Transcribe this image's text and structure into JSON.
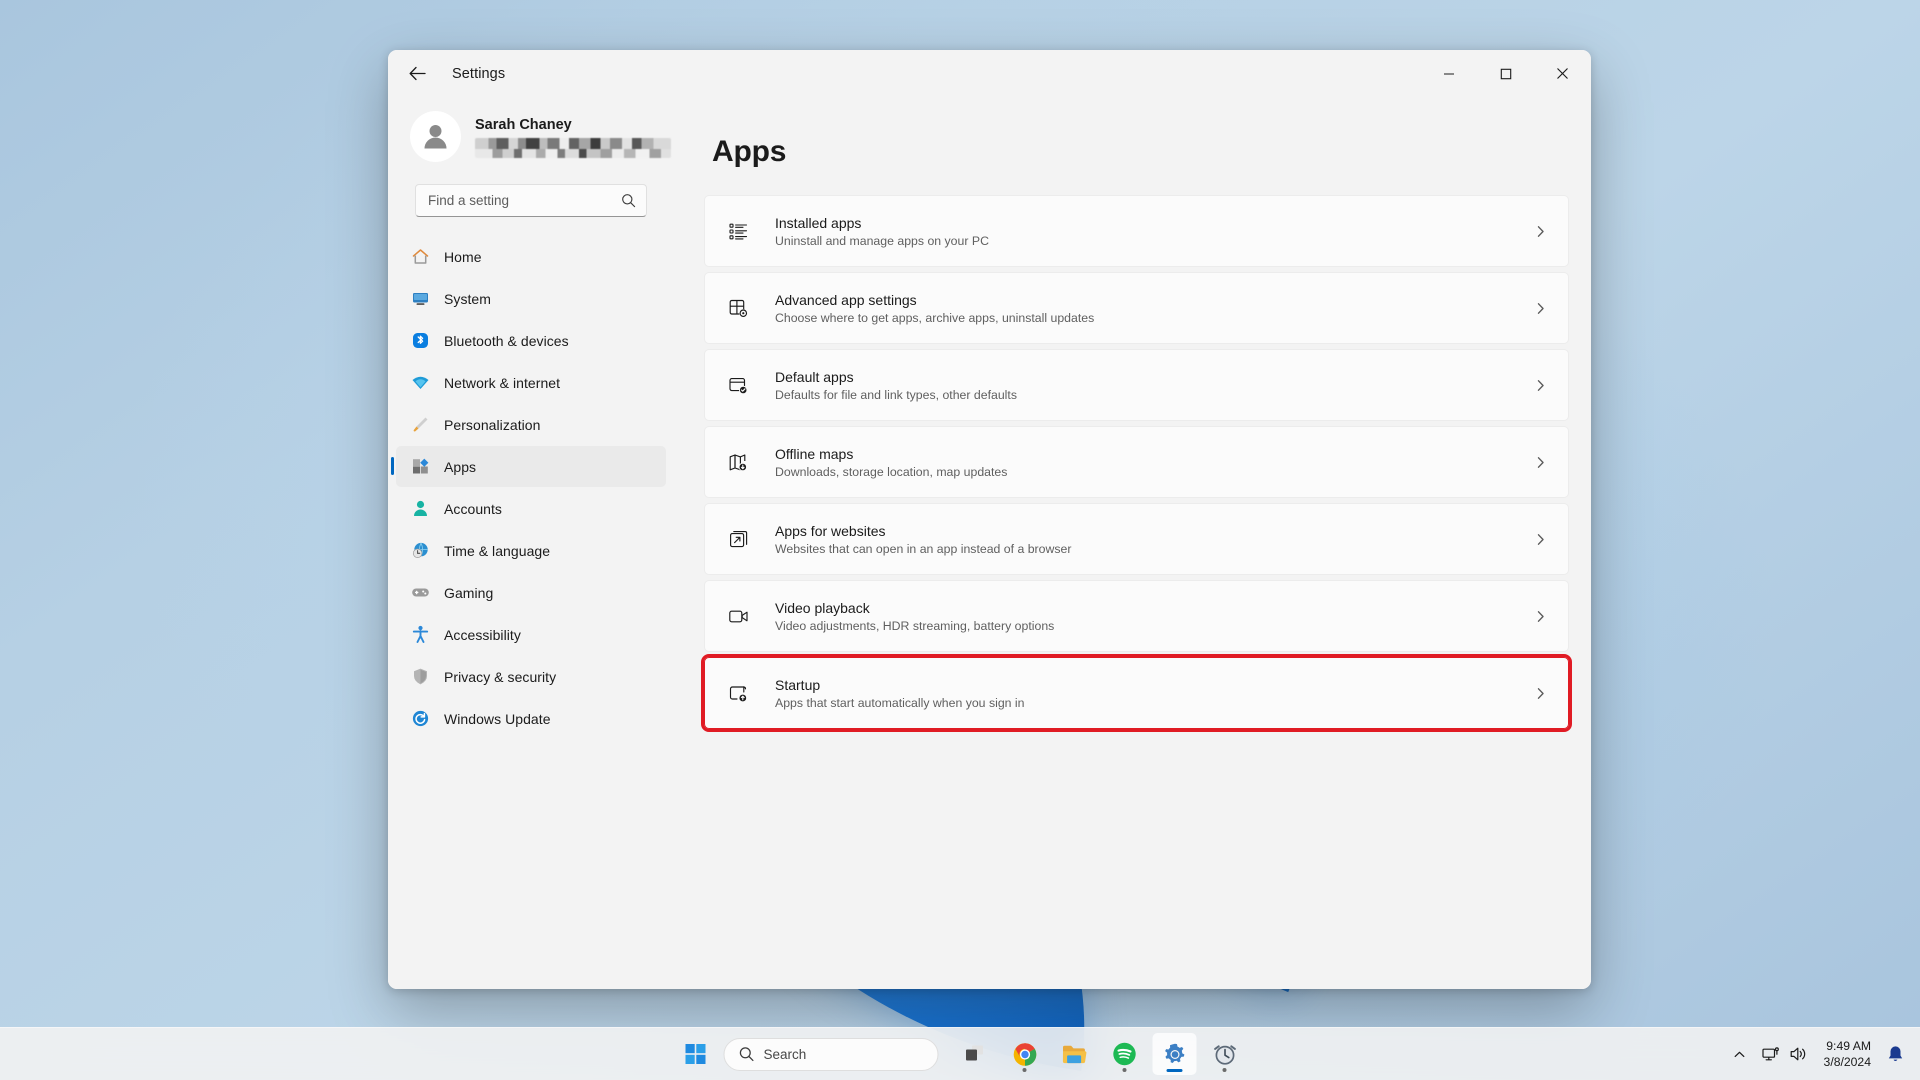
{
  "window": {
    "title": "Settings",
    "back_icon": "back-arrow-icon",
    "minimize_label": "Minimize",
    "maximize_label": "Maximize",
    "close_label": "Close"
  },
  "account": {
    "name": "Sarah Chaney",
    "email_redacted": true
  },
  "search": {
    "placeholder": "Find a setting",
    "value": "",
    "icon": "search-icon"
  },
  "sidebar": {
    "items": [
      {
        "label": "Home",
        "icon": "home-icon",
        "selected": false
      },
      {
        "label": "System",
        "icon": "system-icon",
        "selected": false
      },
      {
        "label": "Bluetooth & devices",
        "icon": "bluetooth-icon",
        "selected": false
      },
      {
        "label": "Network & internet",
        "icon": "wifi-icon",
        "selected": false
      },
      {
        "label": "Personalization",
        "icon": "paintbrush-icon",
        "selected": false
      },
      {
        "label": "Apps",
        "icon": "apps-icon",
        "selected": true
      },
      {
        "label": "Accounts",
        "icon": "account-icon",
        "selected": false
      },
      {
        "label": "Time & language",
        "icon": "clock-globe-icon",
        "selected": false
      },
      {
        "label": "Gaming",
        "icon": "gamepad-icon",
        "selected": false
      },
      {
        "label": "Accessibility",
        "icon": "accessibility-icon",
        "selected": false
      },
      {
        "label": "Privacy & security",
        "icon": "shield-icon",
        "selected": false
      },
      {
        "label": "Windows Update",
        "icon": "update-icon",
        "selected": false
      }
    ]
  },
  "main": {
    "page_title": "Apps",
    "cards": [
      {
        "title": "Installed apps",
        "subtitle": "Uninstall and manage apps on your PC",
        "icon": "list-icon",
        "highlighted": false
      },
      {
        "title": "Advanced app settings",
        "subtitle": "Choose where to get apps, archive apps, uninstall updates",
        "icon": "app-gear-icon",
        "highlighted": false
      },
      {
        "title": "Default apps",
        "subtitle": "Defaults for file and link types, other defaults",
        "icon": "default-app-icon",
        "highlighted": false
      },
      {
        "title": "Offline maps",
        "subtitle": "Downloads, storage location, map updates",
        "icon": "map-download-icon",
        "highlighted": false
      },
      {
        "title": "Apps for websites",
        "subtitle": "Websites that can open in an app instead of a browser",
        "icon": "external-link-icon",
        "highlighted": false
      },
      {
        "title": "Video playback",
        "subtitle": "Video adjustments, HDR streaming, battery options",
        "icon": "video-icon",
        "highlighted": false
      },
      {
        "title": "Startup",
        "subtitle": "Apps that start automatically when you sign in",
        "icon": "startup-icon",
        "highlighted": true
      }
    ],
    "chevron_icon": "chevron-right-icon"
  },
  "taskbar": {
    "start_label": "Start",
    "search_placeholder": "Search",
    "search_icon": "search-icon",
    "buttons": [
      {
        "name": "task-view",
        "label": "Task view"
      },
      {
        "name": "chrome",
        "label": "Google Chrome"
      },
      {
        "name": "file-explorer",
        "label": "File Explorer"
      },
      {
        "name": "spotify",
        "label": "Spotify"
      },
      {
        "name": "settings",
        "label": "Settings"
      },
      {
        "name": "clock-app",
        "label": "Clock"
      }
    ],
    "tray": {
      "chevron_icon": "chevron-up-icon",
      "network_icon": "network-icon",
      "volume_icon": "volume-icon",
      "time": "9:49 AM",
      "date": "3/8/2024",
      "notification_icon": "bell-icon"
    }
  },
  "colors": {
    "accent": "#0067c0",
    "highlight_border": "#e01b24",
    "window_bg": "#f3f3f3",
    "card_bg": "#fbfbfb"
  }
}
